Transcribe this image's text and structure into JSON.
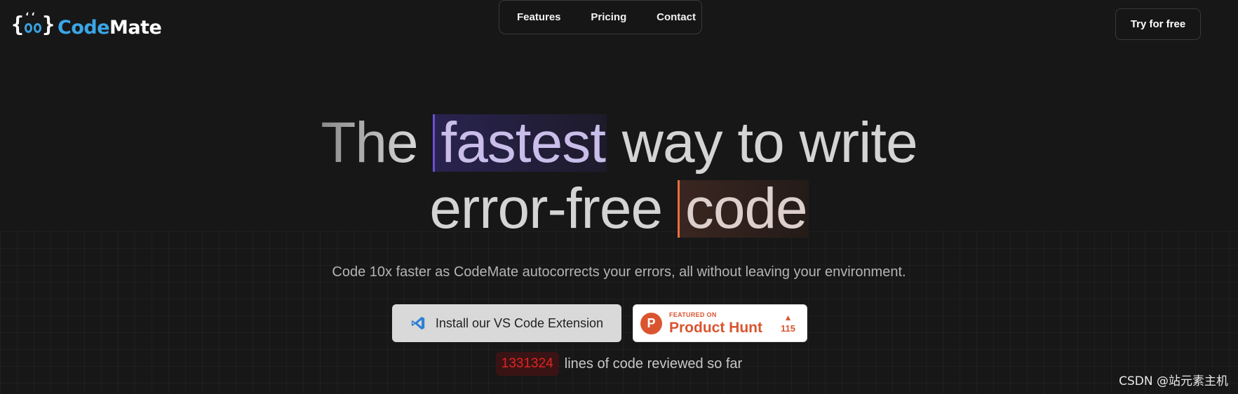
{
  "logo": {
    "brace_left": "{",
    "brace_right": "}",
    "lashes": "ʻʻ",
    "name_part1": "Code",
    "name_part2": "Mate"
  },
  "nav": {
    "items": [
      {
        "label": "Features"
      },
      {
        "label": "Pricing"
      },
      {
        "label": "Contact"
      }
    ]
  },
  "header": {
    "cta_label": "Try for free"
  },
  "hero": {
    "line1": {
      "pre": "The",
      "highlight": "fastest",
      "post": "way to write"
    },
    "line2": {
      "pre": "error-free",
      "highlight": "code"
    },
    "subtitle": "Code 10x faster as CodeMate autocorrects your errors, all without leaving your environment.",
    "vs_button_label": "Install our VS Code Extension",
    "product_hunt": {
      "logo_letter": "P",
      "featured": "FEATURED ON",
      "name": "Product Hunt",
      "arrow": "▲",
      "votes": "115"
    },
    "stats": {
      "count": "1331324",
      "label": "lines of code reviewed so far"
    }
  },
  "watermark": "CSDN @站元素主机",
  "colors": {
    "background": "#171717",
    "brand_blue": "#3aa6e6",
    "highlight_purple": "#6b4fd6",
    "highlight_orange": "#e8703f",
    "product_hunt": "#da552f",
    "counter_red": "#e02424"
  },
  "icons": {
    "vs_button": "vscode-icon",
    "product_hunt_logo": "product-hunt-logo-icon",
    "upvote": "upvote-arrow-icon"
  }
}
